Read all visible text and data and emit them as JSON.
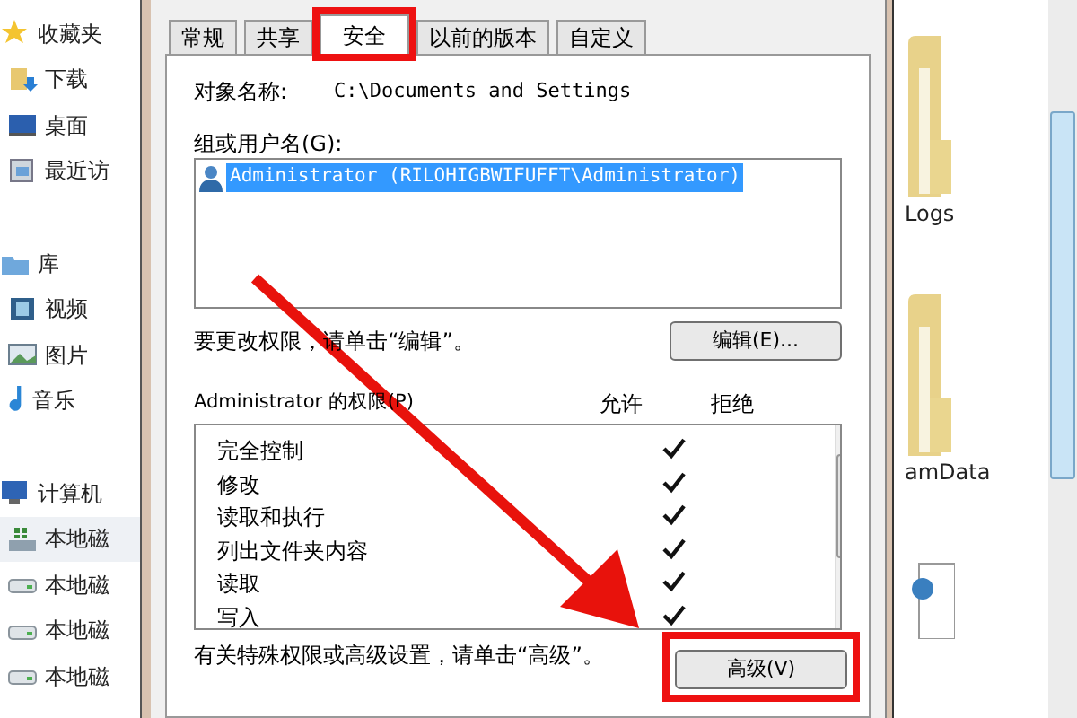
{
  "sidebar": {
    "items": [
      {
        "label": "收藏夹",
        "kind": "star"
      },
      {
        "label": "下载",
        "kind": "download"
      },
      {
        "label": "桌面",
        "kind": "desktop"
      },
      {
        "label": "最近访",
        "kind": "recent"
      },
      {
        "label": "库",
        "kind": "library"
      },
      {
        "label": "视频",
        "kind": "video"
      },
      {
        "label": "图片",
        "kind": "picture"
      },
      {
        "label": "音乐",
        "kind": "music"
      },
      {
        "label": "计算机",
        "kind": "computer"
      },
      {
        "label": "本地磁",
        "kind": "systemdrive",
        "selected": true
      },
      {
        "label": "本地磁",
        "kind": "drive",
        "selected": false
      },
      {
        "label": "本地磁",
        "kind": "drive",
        "selected": false
      },
      {
        "label": "本地磁",
        "kind": "drive",
        "selected": false
      }
    ]
  },
  "dialog": {
    "tabs": [
      {
        "label": "常规",
        "selected": false
      },
      {
        "label": "共享",
        "selected": false
      },
      {
        "label": "安全",
        "selected": true,
        "highlighted": true
      },
      {
        "label": "以前的版本",
        "selected": false
      },
      {
        "label": "自定义",
        "selected": false
      }
    ],
    "object_label": "对象名称:",
    "object_name": "C:\\Documents and Settings",
    "groups_label": "组或用户名(G):",
    "users": [
      {
        "name": "Administrator (RILOHIGBWIFUFFT\\Administrator)",
        "selected": true
      }
    ],
    "change_hint": "要更改权限，请单击“编辑”。",
    "edit_button": "编辑(E)...",
    "permissions_label": "Administrator 的权限(P)",
    "allow_header": "允许",
    "deny_header": "拒绝",
    "permissions": [
      {
        "name": "完全控制",
        "allow": true,
        "deny": false
      },
      {
        "name": "修改",
        "allow": true,
        "deny": false
      },
      {
        "name": "读取和执行",
        "allow": true,
        "deny": false
      },
      {
        "name": "列出文件夹内容",
        "allow": true,
        "deny": false
      },
      {
        "name": "读取",
        "allow": true,
        "deny": false
      },
      {
        "name": "写入",
        "allow": true,
        "deny": false
      }
    ],
    "advanced_hint": "有关特殊权限或高级设置，请单击“高级”。",
    "advanced_button": "高级(V)",
    "advanced_highlighted": true
  },
  "files": [
    {
      "name": "Logs",
      "kind": "folder"
    },
    {
      "name": "amData",
      "kind": "folder"
    },
    {
      "kind": "document"
    }
  ]
}
